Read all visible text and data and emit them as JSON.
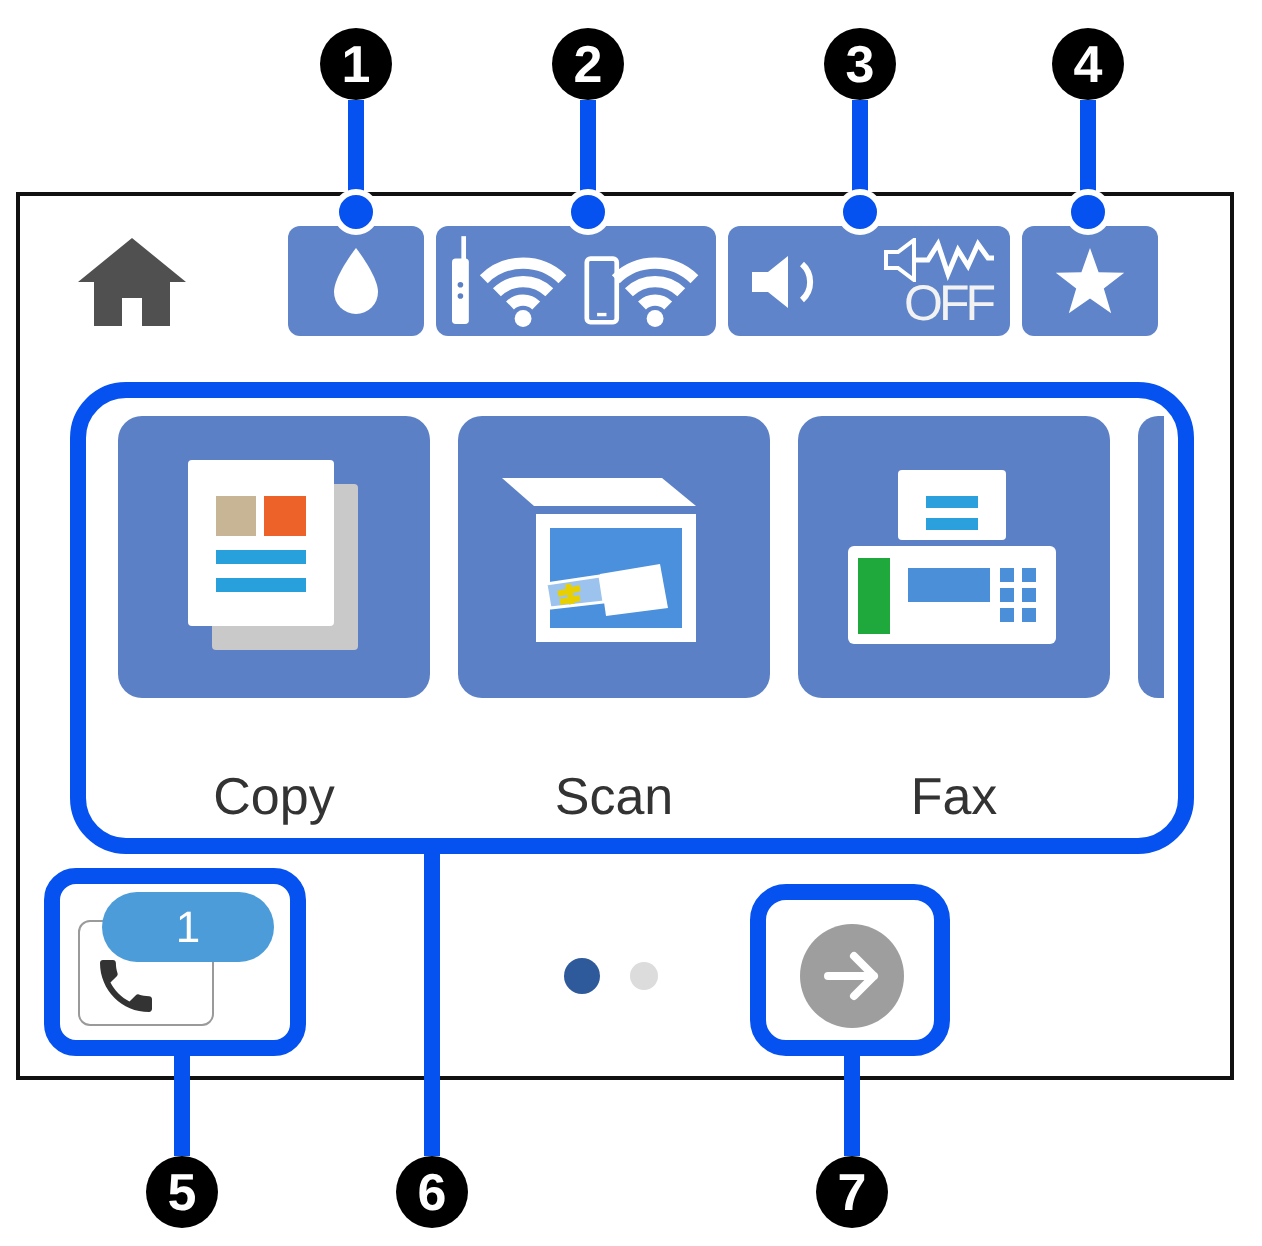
{
  "callouts": [
    {
      "number": "1"
    },
    {
      "number": "2"
    },
    {
      "number": "3"
    },
    {
      "number": "4"
    },
    {
      "number": "5"
    },
    {
      "number": "6"
    },
    {
      "number": "7"
    }
  ],
  "screen": {
    "status_bar": {
      "sound_off_text": "OFF"
    },
    "menu_tiles": [
      {
        "kind": "copy",
        "label": "Copy"
      },
      {
        "kind": "scan",
        "label": "Scan"
      },
      {
        "kind": "fax",
        "label": "Fax"
      }
    ],
    "phone_button": {
      "badge": "1"
    },
    "page_dots": [
      {
        "selected": true
      },
      {
        "selected": false
      }
    ]
  }
}
